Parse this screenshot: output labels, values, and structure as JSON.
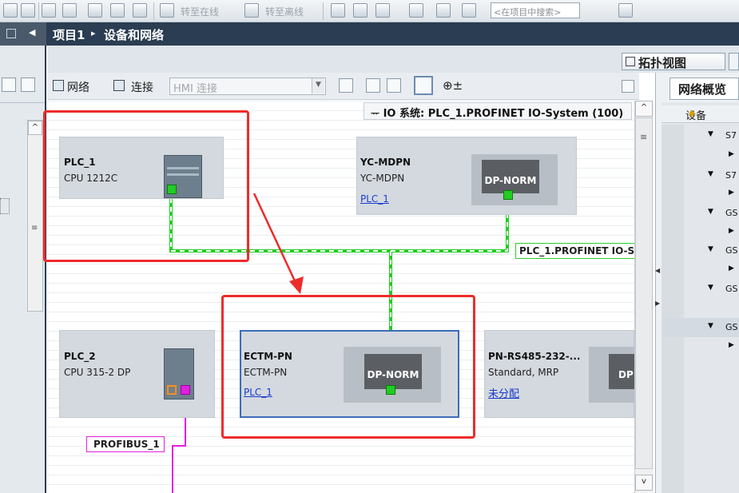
{
  "toolbar": {
    "go_online": "转至在线",
    "go_offline": "转至离线",
    "search_placeholder": "<在项目中搜索>"
  },
  "breadcrumb": {
    "project": "项目1",
    "separator": "▸",
    "page": "设备和网络"
  },
  "view_tabs": {
    "topology": "拓扑视图"
  },
  "editor_toolbar": {
    "network": "网络",
    "connection": "连接",
    "hmi_connection": "HMI 连接"
  },
  "io_system": {
    "label": "IO 系统: PLC_1.PROFINET IO-System (100)"
  },
  "devices": [
    {
      "name": "PLC_1",
      "type": "CPU 1212C",
      "link": ""
    },
    {
      "name": "YC-MDPN",
      "type": "YC-MDPN",
      "link": "PLC_1",
      "module": "DP-NORM"
    },
    {
      "name": "PLC_2",
      "type": "CPU 315-2 DP",
      "link": ""
    },
    {
      "name": "ECTM-PN",
      "type": "ECTM-PN",
      "link": "PLC_1",
      "module": "DP-NORM"
    },
    {
      "name": "PN-RS485-232-...",
      "type": "Standard, MRP",
      "link": "未分配",
      "module": "DP"
    }
  ],
  "network_labels": {
    "profinet": "PLC_1.PROFINET IO-S",
    "profibus": "PROFIBUS_1"
  },
  "overview_panel": {
    "title": "网络概览",
    "device_header": "设备",
    "rows": [
      {
        "expander": "▼",
        "label": "S7"
      },
      {
        "expander": "▶",
        "label": ""
      },
      {
        "expander": "▼",
        "label": "S7"
      },
      {
        "expander": "▶",
        "label": ""
      },
      {
        "expander": "▼",
        "label": "GS"
      },
      {
        "expander": "▶",
        "label": ""
      },
      {
        "expander": "▼",
        "label": "GS"
      },
      {
        "expander": "▶",
        "label": ""
      },
      {
        "expander": "▼",
        "label": "GS"
      },
      {
        "expander": "",
        "label": ""
      },
      {
        "expander": "▼",
        "label": "GS"
      },
      {
        "expander": "▶",
        "label": ""
      }
    ]
  },
  "colors": {
    "title_bar": "#2b3d52",
    "profinet_line": "#22cc22",
    "profibus_line": "#e020e0",
    "annotation": "#ee2b2b",
    "link": "#1a3ccc"
  }
}
